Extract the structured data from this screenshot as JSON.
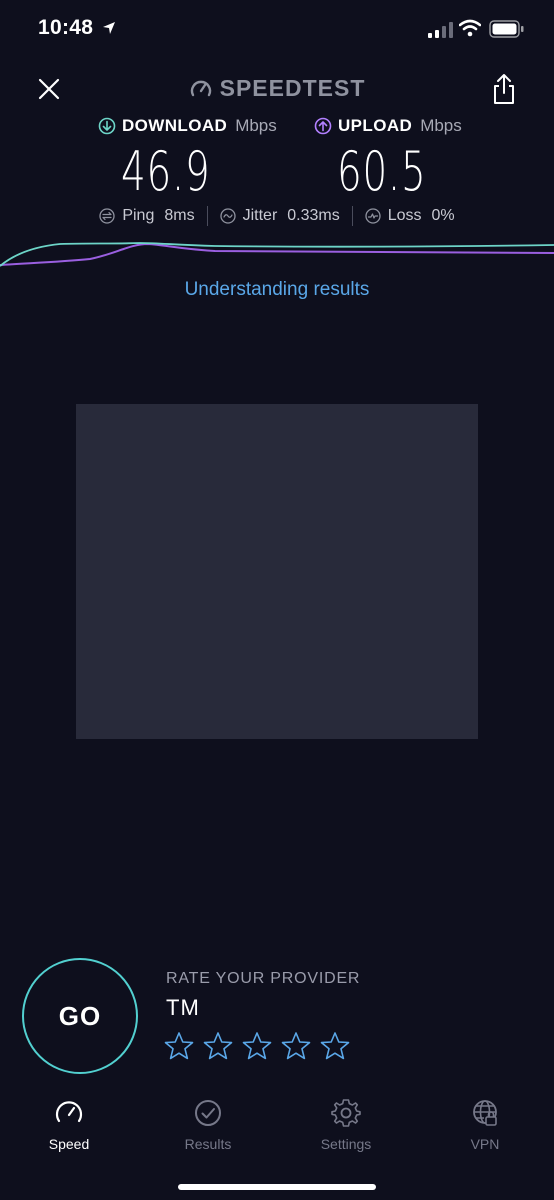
{
  "status_bar": {
    "time": "10:48"
  },
  "header": {
    "logo_text": "SPEEDTEST"
  },
  "download": {
    "label": "DOWNLOAD",
    "unit": "Mbps",
    "value": "46.9",
    "color": "#6dd5c8"
  },
  "upload": {
    "label": "UPLOAD",
    "unit": "Mbps",
    "value": "60.5",
    "color": "#b280ff"
  },
  "stats": {
    "ping": {
      "label": "Ping",
      "value": "8ms"
    },
    "jitter": {
      "label": "Jitter",
      "value": "0.33ms"
    },
    "loss": {
      "label": "Loss",
      "value": "0%"
    }
  },
  "link": {
    "understanding": "Understanding results"
  },
  "go": {
    "label": "GO"
  },
  "rating": {
    "title": "RATE YOUR PROVIDER",
    "provider": "TM",
    "stars_filled": 0,
    "stars_total": 5
  },
  "tabs": [
    {
      "label": "Speed",
      "icon": "speed-gauge-icon",
      "active": true
    },
    {
      "label": "Results",
      "icon": "check-circle-icon",
      "active": false
    },
    {
      "label": "Settings",
      "icon": "gear-icon",
      "active": false
    },
    {
      "label": "VPN",
      "icon": "globe-lock-icon",
      "active": false
    }
  ],
  "colors": {
    "background": "#0e0f1d",
    "accent_blue": "#5aa7e8",
    "go_ring": "#52d0d0",
    "ad_placeholder": "#282a3a"
  }
}
